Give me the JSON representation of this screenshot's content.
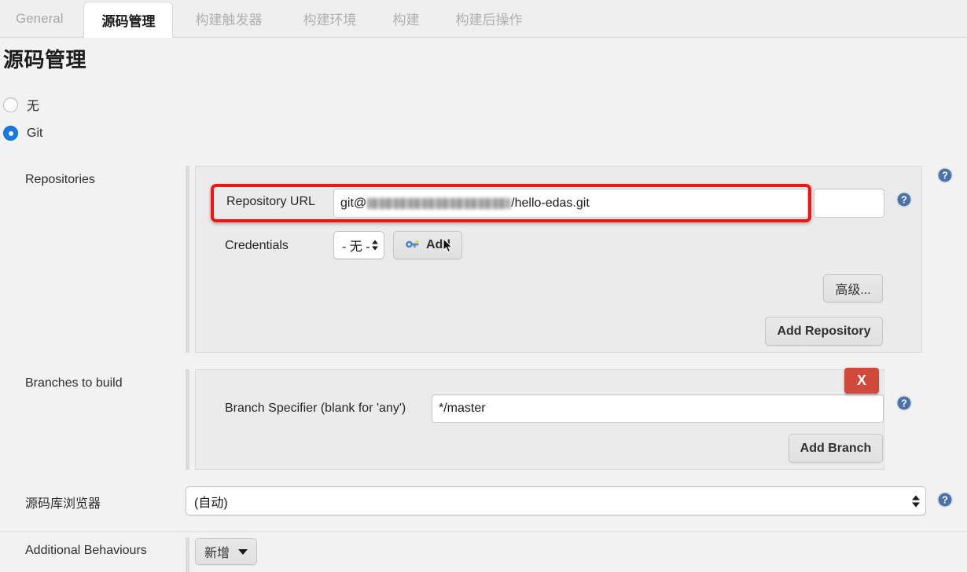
{
  "tabs": [
    {
      "label": "General",
      "active": false
    },
    {
      "label": "源码管理",
      "active": true
    },
    {
      "label": "构建触发器",
      "active": false
    },
    {
      "label": "构建环境",
      "active": false
    },
    {
      "label": "构建",
      "active": false
    },
    {
      "label": "构建后操作",
      "active": false
    }
  ],
  "page": {
    "title": "源码管理"
  },
  "scm_options": [
    {
      "label": "无",
      "selected": false
    },
    {
      "label": "Git",
      "selected": true
    }
  ],
  "repositories": {
    "label": "Repositories",
    "repository_url": {
      "label": "Repository URL",
      "value_prefix": "git@",
      "value_redacted": "[redacted]",
      "value_suffix": "/hello-edas.git"
    },
    "credentials": {
      "label": "Credentials",
      "select_value": "- 无 -",
      "add_button": "Add",
      "add_icon": "key-icon"
    },
    "advanced_button": "高级...",
    "add_repository_button": "Add Repository"
  },
  "branches": {
    "label": "Branches to build",
    "delete_button": "X",
    "branch_specifier": {
      "label": "Branch Specifier (blank for 'any')",
      "value": "*/master"
    },
    "add_branch_button": "Add Branch"
  },
  "repository_browser": {
    "label": "源码库浏览器",
    "value": "(自动)"
  },
  "additional_behaviours": {
    "label": "Additional Behaviours",
    "add_button": "新增"
  },
  "colors": {
    "accent_blue": "#1779e8",
    "danger_red": "#cf4a3d",
    "annotation_red": "#f01616",
    "help_blue": "#4a72a8",
    "page_bg": "#f2f2f2",
    "panel_bg": "#ebebeb"
  },
  "icons": {
    "help": "help-circle-icon",
    "dropdown": "chevron-down-icon",
    "stepper": "stepper-arrows-icon",
    "cursor": "mouse-pointer-icon"
  }
}
